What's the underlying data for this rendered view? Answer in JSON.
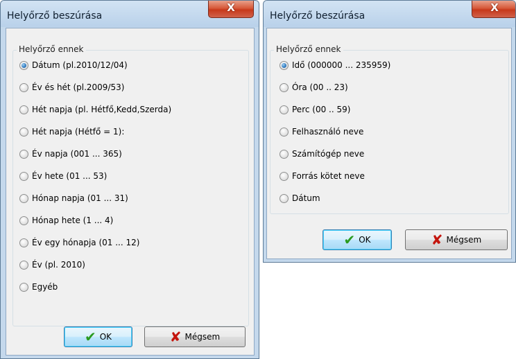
{
  "dialog_left": {
    "title": "Helyőrző beszúrása",
    "close_glyph": "X",
    "group_label": "Helyőrző ennek",
    "options": [
      {
        "label": "Dátum (pl.2010/12/04)",
        "checked": true
      },
      {
        "label": "Év és hét (pl.2009/53)",
        "checked": false
      },
      {
        "label": "Hét napja (pl. Hétfő,Kedd,Szerda)",
        "checked": false
      },
      {
        "label": "Hét napja (Hétfő = 1):",
        "checked": false
      },
      {
        "label": "Év napja  (001 ... 365)",
        "checked": false
      },
      {
        "label": "Év hete (01 ... 53)",
        "checked": false
      },
      {
        "label": "Hónap napja (01 ... 31)",
        "checked": false
      },
      {
        "label": "Hónap hete (1 ... 4)",
        "checked": false
      },
      {
        "label": "Év egy hónapja (01 ... 12)",
        "checked": false
      },
      {
        "label": "Év  (pl. 2010)",
        "checked": false
      },
      {
        "label": "Egyéb",
        "checked": false
      }
    ],
    "ok_label": "OK",
    "cancel_label": "Mégsem"
  },
  "dialog_right": {
    "title": "Helyőrző beszúrása",
    "close_glyph": "X",
    "group_label": "Helyőrző ennek",
    "options": [
      {
        "label": "Idő (000000 ... 235959)",
        "checked": true
      },
      {
        "label": "Óra (00 .. 23)",
        "checked": false
      },
      {
        "label": "Perc (00 .. 59)",
        "checked": false
      },
      {
        "label": "Felhasználó neve",
        "checked": false
      },
      {
        "label": "Számítógép neve",
        "checked": false
      },
      {
        "label": "Forrás kötet neve",
        "checked": false
      },
      {
        "label": "Dátum",
        "checked": false
      }
    ],
    "ok_label": "OK",
    "cancel_label": "Mégsem"
  },
  "icons": {
    "ok": "checkmark-icon",
    "cancel": "cross-icon",
    "check_glyph": "✔",
    "cross_glyph": "✘"
  },
  "colors": {
    "window_frame": "#c4d8ec",
    "close_button": "#c7391b",
    "radio_selected": "#2f79bf",
    "ok_check": "#2a9a1f",
    "cancel_cross": "#c4150d"
  }
}
